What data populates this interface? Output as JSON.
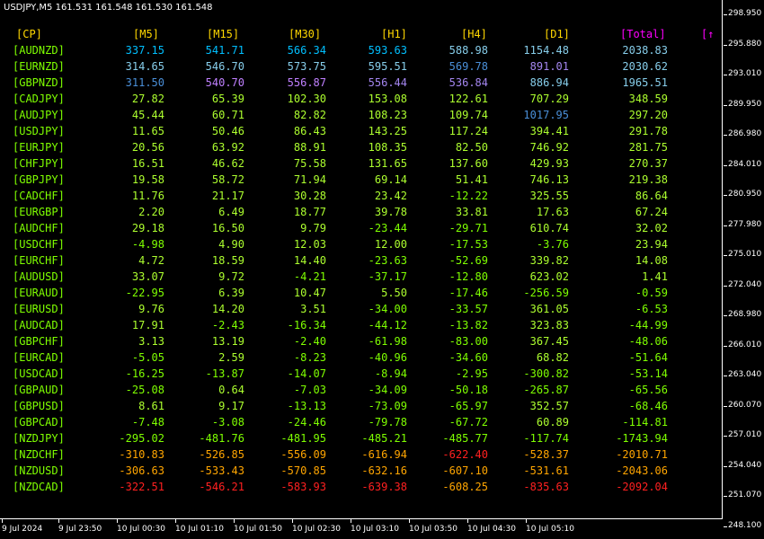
{
  "title": "USDJPY,M5  161.531 161.548 161.530 161.548",
  "colors": {
    "header": "#ffd700",
    "total_header": "#ff00ff",
    "pair": "#7fff00",
    "deep_blue": "#1e90ff",
    "sky_blue": "#00bfff",
    "light_blue": "#87ceeb",
    "steel_blue": "#4a8fd8",
    "purple": "#a486f0",
    "orchid": "#c080ff",
    "green": "#7fff00",
    "yellow_green": "#adff2f",
    "orange": "#ffa500",
    "red": "#ff2020"
  },
  "headers": {
    "cp": "[CP]",
    "m5": "[M5]",
    "m15": "[M15]",
    "m30": "[M30]",
    "h1": "[H1]",
    "h4": "[H4]",
    "d1": "[D1]",
    "total": "[Total]",
    "extra": "[↑"
  },
  "rows": [
    {
      "pair": "[AUDNZD]",
      "m5": {
        "v": "337.15",
        "c": "sky_blue"
      },
      "m15": {
        "v": "541.71",
        "c": "sky_blue"
      },
      "m30": {
        "v": "566.34",
        "c": "sky_blue"
      },
      "h1": {
        "v": "593.63",
        "c": "sky_blue"
      },
      "h4": {
        "v": "588.98",
        "c": "light_blue"
      },
      "d1": {
        "v": "1154.48",
        "c": "light_blue"
      },
      "total": {
        "v": "2038.83",
        "c": "light_blue"
      }
    },
    {
      "pair": "[EURNZD]",
      "m5": {
        "v": "314.65",
        "c": "light_blue"
      },
      "m15": {
        "v": "546.70",
        "c": "light_blue"
      },
      "m30": {
        "v": "573.75",
        "c": "light_blue"
      },
      "h1": {
        "v": "595.51",
        "c": "light_blue"
      },
      "h4": {
        "v": "569.78",
        "c": "steel_blue"
      },
      "d1": {
        "v": "891.01",
        "c": "purple"
      },
      "total": {
        "v": "2030.62",
        "c": "light_blue"
      }
    },
    {
      "pair": "[GBPNZD]",
      "m5": {
        "v": "311.50",
        "c": "steel_blue"
      },
      "m15": {
        "v": "540.70",
        "c": "orchid"
      },
      "m30": {
        "v": "556.87",
        "c": "orchid"
      },
      "h1": {
        "v": "556.44",
        "c": "purple"
      },
      "h4": {
        "v": "536.84",
        "c": "purple"
      },
      "d1": {
        "v": "886.94",
        "c": "light_blue"
      },
      "total": {
        "v": "1965.51",
        "c": "light_blue"
      }
    },
    {
      "pair": "[CADJPY]",
      "m5": {
        "v": "27.82",
        "c": "yellow_green"
      },
      "m15": {
        "v": "65.39",
        "c": "yellow_green"
      },
      "m30": {
        "v": "102.30",
        "c": "yellow_green"
      },
      "h1": {
        "v": "153.08",
        "c": "yellow_green"
      },
      "h4": {
        "v": "122.61",
        "c": "yellow_green"
      },
      "d1": {
        "v": "707.29",
        "c": "yellow_green"
      },
      "total": {
        "v": "348.59",
        "c": "yellow_green"
      }
    },
    {
      "pair": "[AUDJPY]",
      "m5": {
        "v": "45.44",
        "c": "yellow_green"
      },
      "m15": {
        "v": "60.71",
        "c": "yellow_green"
      },
      "m30": {
        "v": "82.82",
        "c": "yellow_green"
      },
      "h1": {
        "v": "108.23",
        "c": "yellow_green"
      },
      "h4": {
        "v": "109.74",
        "c": "yellow_green"
      },
      "d1": {
        "v": "1017.95",
        "c": "steel_blue"
      },
      "total": {
        "v": "297.20",
        "c": "yellow_green"
      }
    },
    {
      "pair": "[USDJPY]",
      "m5": {
        "v": "11.65",
        "c": "yellow_green"
      },
      "m15": {
        "v": "50.46",
        "c": "yellow_green"
      },
      "m30": {
        "v": "86.43",
        "c": "yellow_green"
      },
      "h1": {
        "v": "143.25",
        "c": "yellow_green"
      },
      "h4": {
        "v": "117.24",
        "c": "yellow_green"
      },
      "d1": {
        "v": "394.41",
        "c": "yellow_green"
      },
      "total": {
        "v": "291.78",
        "c": "yellow_green"
      }
    },
    {
      "pair": "[EURJPY]",
      "m5": {
        "v": "20.56",
        "c": "yellow_green"
      },
      "m15": {
        "v": "63.92",
        "c": "yellow_green"
      },
      "m30": {
        "v": "88.91",
        "c": "yellow_green"
      },
      "h1": {
        "v": "108.35",
        "c": "yellow_green"
      },
      "h4": {
        "v": "82.50",
        "c": "yellow_green"
      },
      "d1": {
        "v": "746.92",
        "c": "yellow_green"
      },
      "total": {
        "v": "281.75",
        "c": "yellow_green"
      }
    },
    {
      "pair": "[CHFJPY]",
      "m5": {
        "v": "16.51",
        "c": "yellow_green"
      },
      "m15": {
        "v": "46.62",
        "c": "yellow_green"
      },
      "m30": {
        "v": "75.58",
        "c": "yellow_green"
      },
      "h1": {
        "v": "131.65",
        "c": "yellow_green"
      },
      "h4": {
        "v": "137.60",
        "c": "yellow_green"
      },
      "d1": {
        "v": "429.93",
        "c": "yellow_green"
      },
      "total": {
        "v": "270.37",
        "c": "yellow_green"
      }
    },
    {
      "pair": "[GBPJPY]",
      "m5": {
        "v": "19.58",
        "c": "yellow_green"
      },
      "m15": {
        "v": "58.72",
        "c": "yellow_green"
      },
      "m30": {
        "v": "71.94",
        "c": "yellow_green"
      },
      "h1": {
        "v": "69.14",
        "c": "yellow_green"
      },
      "h4": {
        "v": "51.41",
        "c": "yellow_green"
      },
      "d1": {
        "v": "746.13",
        "c": "yellow_green"
      },
      "total": {
        "v": "219.38",
        "c": "yellow_green"
      }
    },
    {
      "pair": "[CADCHF]",
      "m5": {
        "v": "11.76",
        "c": "yellow_green"
      },
      "m15": {
        "v": "21.17",
        "c": "yellow_green"
      },
      "m30": {
        "v": "30.28",
        "c": "yellow_green"
      },
      "h1": {
        "v": "23.42",
        "c": "yellow_green"
      },
      "h4": {
        "v": "-12.22",
        "c": "green"
      },
      "d1": {
        "v": "325.55",
        "c": "yellow_green"
      },
      "total": {
        "v": "86.64",
        "c": "yellow_green"
      }
    },
    {
      "pair": "[EURGBP]",
      "m5": {
        "v": "2.20",
        "c": "yellow_green"
      },
      "m15": {
        "v": "6.49",
        "c": "yellow_green"
      },
      "m30": {
        "v": "18.77",
        "c": "yellow_green"
      },
      "h1": {
        "v": "39.78",
        "c": "yellow_green"
      },
      "h4": {
        "v": "33.81",
        "c": "yellow_green"
      },
      "d1": {
        "v": "17.63",
        "c": "yellow_green"
      },
      "total": {
        "v": "67.24",
        "c": "yellow_green"
      }
    },
    {
      "pair": "[AUDCHF]",
      "m5": {
        "v": "29.18",
        "c": "yellow_green"
      },
      "m15": {
        "v": "16.50",
        "c": "yellow_green"
      },
      "m30": {
        "v": "9.79",
        "c": "yellow_green"
      },
      "h1": {
        "v": "-23.44",
        "c": "green"
      },
      "h4": {
        "v": "-29.71",
        "c": "green"
      },
      "d1": {
        "v": "610.74",
        "c": "yellow_green"
      },
      "total": {
        "v": "32.02",
        "c": "yellow_green"
      }
    },
    {
      "pair": "[USDCHF]",
      "m5": {
        "v": "-4.98",
        "c": "green"
      },
      "m15": {
        "v": "4.90",
        "c": "yellow_green"
      },
      "m30": {
        "v": "12.03",
        "c": "yellow_green"
      },
      "h1": {
        "v": "12.00",
        "c": "yellow_green"
      },
      "h4": {
        "v": "-17.53",
        "c": "green"
      },
      "d1": {
        "v": "-3.76",
        "c": "green"
      },
      "total": {
        "v": "23.94",
        "c": "yellow_green"
      }
    },
    {
      "pair": "[EURCHF]",
      "m5": {
        "v": "4.72",
        "c": "yellow_green"
      },
      "m15": {
        "v": "18.59",
        "c": "yellow_green"
      },
      "m30": {
        "v": "14.40",
        "c": "yellow_green"
      },
      "h1": {
        "v": "-23.63",
        "c": "green"
      },
      "h4": {
        "v": "-52.69",
        "c": "green"
      },
      "d1": {
        "v": "339.82",
        "c": "yellow_green"
      },
      "total": {
        "v": "14.08",
        "c": "yellow_green"
      }
    },
    {
      "pair": "[AUDUSD]",
      "m5": {
        "v": "33.07",
        "c": "yellow_green"
      },
      "m15": {
        "v": "9.72",
        "c": "yellow_green"
      },
      "m30": {
        "v": "-4.21",
        "c": "green"
      },
      "h1": {
        "v": "-37.17",
        "c": "green"
      },
      "h4": {
        "v": "-12.80",
        "c": "green"
      },
      "d1": {
        "v": "623.02",
        "c": "yellow_green"
      },
      "total": {
        "v": "1.41",
        "c": "yellow_green"
      }
    },
    {
      "pair": "[EURAUD]",
      "m5": {
        "v": "-22.95",
        "c": "green"
      },
      "m15": {
        "v": "6.39",
        "c": "yellow_green"
      },
      "m30": {
        "v": "10.47",
        "c": "yellow_green"
      },
      "h1": {
        "v": "5.50",
        "c": "yellow_green"
      },
      "h4": {
        "v": "-17.46",
        "c": "green"
      },
      "d1": {
        "v": "-256.59",
        "c": "green"
      },
      "total": {
        "v": "-0.59",
        "c": "green"
      }
    },
    {
      "pair": "[EURUSD]",
      "m5": {
        "v": "9.76",
        "c": "yellow_green"
      },
      "m15": {
        "v": "14.20",
        "c": "yellow_green"
      },
      "m30": {
        "v": "3.51",
        "c": "yellow_green"
      },
      "h1": {
        "v": "-34.00",
        "c": "green"
      },
      "h4": {
        "v": "-33.57",
        "c": "green"
      },
      "d1": {
        "v": "361.05",
        "c": "yellow_green"
      },
      "total": {
        "v": "-6.53",
        "c": "green"
      }
    },
    {
      "pair": "[AUDCAD]",
      "m5": {
        "v": "17.91",
        "c": "yellow_green"
      },
      "m15": {
        "v": "-2.43",
        "c": "green"
      },
      "m30": {
        "v": "-16.34",
        "c": "green"
      },
      "h1": {
        "v": "-44.12",
        "c": "green"
      },
      "h4": {
        "v": "-13.82",
        "c": "green"
      },
      "d1": {
        "v": "323.83",
        "c": "yellow_green"
      },
      "total": {
        "v": "-44.99",
        "c": "green"
      }
    },
    {
      "pair": "[GBPCHF]",
      "m5": {
        "v": "3.13",
        "c": "yellow_green"
      },
      "m15": {
        "v": "13.19",
        "c": "yellow_green"
      },
      "m30": {
        "v": "-2.40",
        "c": "green"
      },
      "h1": {
        "v": "-61.98",
        "c": "green"
      },
      "h4": {
        "v": "-83.00",
        "c": "green"
      },
      "d1": {
        "v": "367.45",
        "c": "yellow_green"
      },
      "total": {
        "v": "-48.06",
        "c": "green"
      }
    },
    {
      "pair": "[EURCAD]",
      "m5": {
        "v": "-5.05",
        "c": "green"
      },
      "m15": {
        "v": "2.59",
        "c": "yellow_green"
      },
      "m30": {
        "v": "-8.23",
        "c": "green"
      },
      "h1": {
        "v": "-40.96",
        "c": "green"
      },
      "h4": {
        "v": "-34.60",
        "c": "green"
      },
      "d1": {
        "v": "68.82",
        "c": "yellow_green"
      },
      "total": {
        "v": "-51.64",
        "c": "green"
      }
    },
    {
      "pair": "[USDCAD]",
      "m5": {
        "v": "-16.25",
        "c": "green"
      },
      "m15": {
        "v": "-13.87",
        "c": "green"
      },
      "m30": {
        "v": "-14.07",
        "c": "green"
      },
      "h1": {
        "v": "-8.94",
        "c": "green"
      },
      "h4": {
        "v": "-2.95",
        "c": "green"
      },
      "d1": {
        "v": "-300.82",
        "c": "green"
      },
      "total": {
        "v": "-53.14",
        "c": "green"
      }
    },
    {
      "pair": "[GBPAUD]",
      "m5": {
        "v": "-25.08",
        "c": "green"
      },
      "m15": {
        "v": "0.64",
        "c": "yellow_green"
      },
      "m30": {
        "v": "-7.03",
        "c": "green"
      },
      "h1": {
        "v": "-34.09",
        "c": "green"
      },
      "h4": {
        "v": "-50.18",
        "c": "green"
      },
      "d1": {
        "v": "-265.87",
        "c": "green"
      },
      "total": {
        "v": "-65.56",
        "c": "green"
      }
    },
    {
      "pair": "[GBPUSD]",
      "m5": {
        "v": "8.61",
        "c": "yellow_green"
      },
      "m15": {
        "v": "9.17",
        "c": "yellow_green"
      },
      "m30": {
        "v": "-13.13",
        "c": "green"
      },
      "h1": {
        "v": "-73.09",
        "c": "green"
      },
      "h4": {
        "v": "-65.97",
        "c": "green"
      },
      "d1": {
        "v": "352.57",
        "c": "yellow_green"
      },
      "total": {
        "v": "-68.46",
        "c": "green"
      }
    },
    {
      "pair": "[GBPCAD]",
      "m5": {
        "v": "-7.48",
        "c": "green"
      },
      "m15": {
        "v": "-3.08",
        "c": "green"
      },
      "m30": {
        "v": "-24.46",
        "c": "green"
      },
      "h1": {
        "v": "-79.78",
        "c": "green"
      },
      "h4": {
        "v": "-67.72",
        "c": "green"
      },
      "d1": {
        "v": "60.89",
        "c": "yellow_green"
      },
      "total": {
        "v": "-114.81",
        "c": "green"
      }
    },
    {
      "pair": "[NZDJPY]",
      "m5": {
        "v": "-295.02",
        "c": "green"
      },
      "m15": {
        "v": "-481.76",
        "c": "green"
      },
      "m30": {
        "v": "-481.95",
        "c": "green"
      },
      "h1": {
        "v": "-485.21",
        "c": "green"
      },
      "h4": {
        "v": "-485.77",
        "c": "green"
      },
      "d1": {
        "v": "-117.74",
        "c": "green"
      },
      "total": {
        "v": "-1743.94",
        "c": "green"
      }
    },
    {
      "pair": "[NZDCHF]",
      "m5": {
        "v": "-310.83",
        "c": "orange"
      },
      "m15": {
        "v": "-526.85",
        "c": "orange"
      },
      "m30": {
        "v": "-556.09",
        "c": "orange"
      },
      "h1": {
        "v": "-616.94",
        "c": "orange"
      },
      "h4": {
        "v": "-622.40",
        "c": "red"
      },
      "d1": {
        "v": "-528.37",
        "c": "orange"
      },
      "total": {
        "v": "-2010.71",
        "c": "orange"
      }
    },
    {
      "pair": "[NZDUSD]",
      "m5": {
        "v": "-306.63",
        "c": "orange"
      },
      "m15": {
        "v": "-533.43",
        "c": "orange"
      },
      "m30": {
        "v": "-570.85",
        "c": "orange"
      },
      "h1": {
        "v": "-632.16",
        "c": "orange"
      },
      "h4": {
        "v": "-607.10",
        "c": "orange"
      },
      "d1": {
        "v": "-531.61",
        "c": "orange"
      },
      "total": {
        "v": "-2043.06",
        "c": "orange"
      }
    },
    {
      "pair": "[NZDCAD]",
      "m5": {
        "v": "-322.51",
        "c": "red"
      },
      "m15": {
        "v": "-546.21",
        "c": "red"
      },
      "m30": {
        "v": "-583.93",
        "c": "red"
      },
      "h1": {
        "v": "-639.38",
        "c": "red"
      },
      "h4": {
        "v": "-608.25",
        "c": "orange"
      },
      "d1": {
        "v": "-835.63",
        "c": "red"
      },
      "total": {
        "v": "-2092.04",
        "c": "red"
      }
    }
  ],
  "price_axis": [
    "298.950",
    "295.880",
    "293.010",
    "289.950",
    "286.980",
    "284.010",
    "280.950",
    "277.980",
    "275.010",
    "272.040",
    "268.980",
    "266.010",
    "263.040",
    "260.070",
    "257.010",
    "254.040",
    "251.070",
    "248.100"
  ],
  "time_axis": [
    "9 Jul 2024",
    "9 Jul 23:50",
    "10 Jul 00:30",
    "10 Jul 01:10",
    "10 Jul 01:50",
    "10 Jul 02:30",
    "10 Jul 03:10",
    "10 Jul 03:50",
    "10 Jul 04:30",
    "10 Jul 05:10"
  ]
}
